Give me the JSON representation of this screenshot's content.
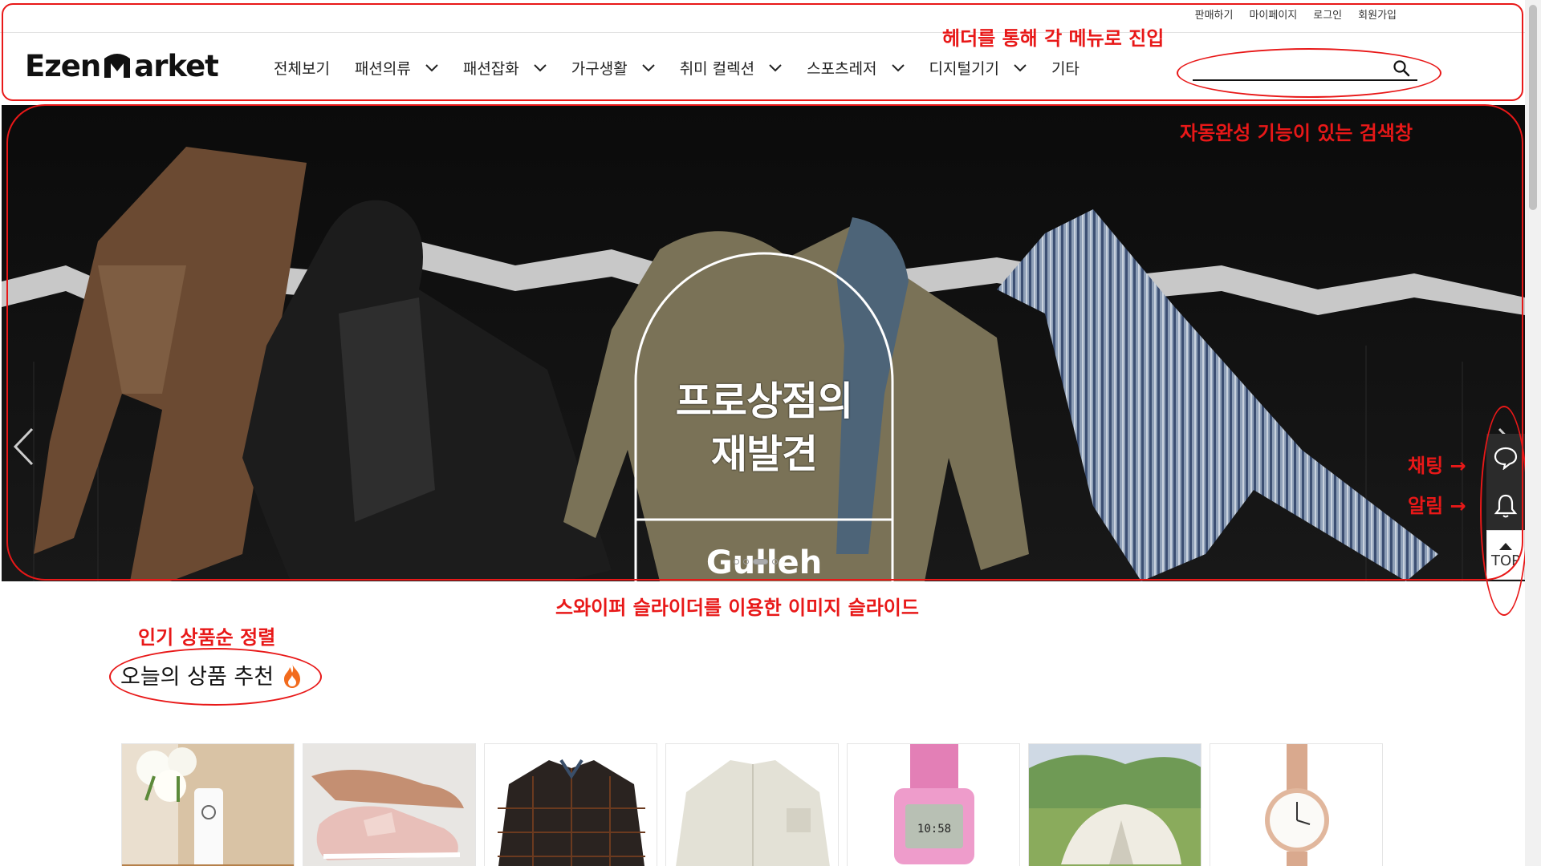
{
  "util_links": [
    "판매하기",
    "마이페이지",
    "로그인",
    "회원가입"
  ],
  "logo": {
    "left": "Ezen",
    "right": "arket"
  },
  "nav": [
    {
      "label": "전체보기",
      "has_dropdown": false
    },
    {
      "label": "패션의류",
      "has_dropdown": true
    },
    {
      "label": "패션잡화",
      "has_dropdown": true
    },
    {
      "label": "가구생활",
      "has_dropdown": true
    },
    {
      "label": "취미 컬렉션",
      "has_dropdown": true
    },
    {
      "label": "스포츠레저",
      "has_dropdown": true
    },
    {
      "label": "디지털기기",
      "has_dropdown": true
    },
    {
      "label": "기타",
      "has_dropdown": false
    }
  ],
  "search": {
    "value": "",
    "placeholder": "",
    "icon": "search-icon"
  },
  "banner": {
    "title_line1": "프로상점의",
    "title_line2": "재발견",
    "brand": "Gulleh",
    "slide_count": 4,
    "active_slide": 2
  },
  "side_widget": {
    "chat_icon": "chat-bubble-icon",
    "bell_icon": "bell-icon",
    "top_label": "TOP"
  },
  "section": {
    "title": "오늘의 상품 추천",
    "icon": "fire-icon"
  },
  "products": [
    "flower-spray",
    "pink-sneakers",
    "plaid-shirt",
    "ivory-jacket",
    "pink-digital-watch",
    "white-tent",
    "rose-gold-watch"
  ],
  "annotations": {
    "header": "헤더를 통해 각 메뉴로 진입",
    "search": "자동완성 기능이 있는 검색창",
    "chat": "채팅 →",
    "alarm": "알림 →",
    "slider": "스와이퍼 슬라이더를 이용한 이미지 슬라이드",
    "sort": "인기 상품순 정렬"
  },
  "colors": {
    "annotation": "#e81818",
    "widget": "#2b2b2b",
    "banner_bg": "#050505"
  }
}
